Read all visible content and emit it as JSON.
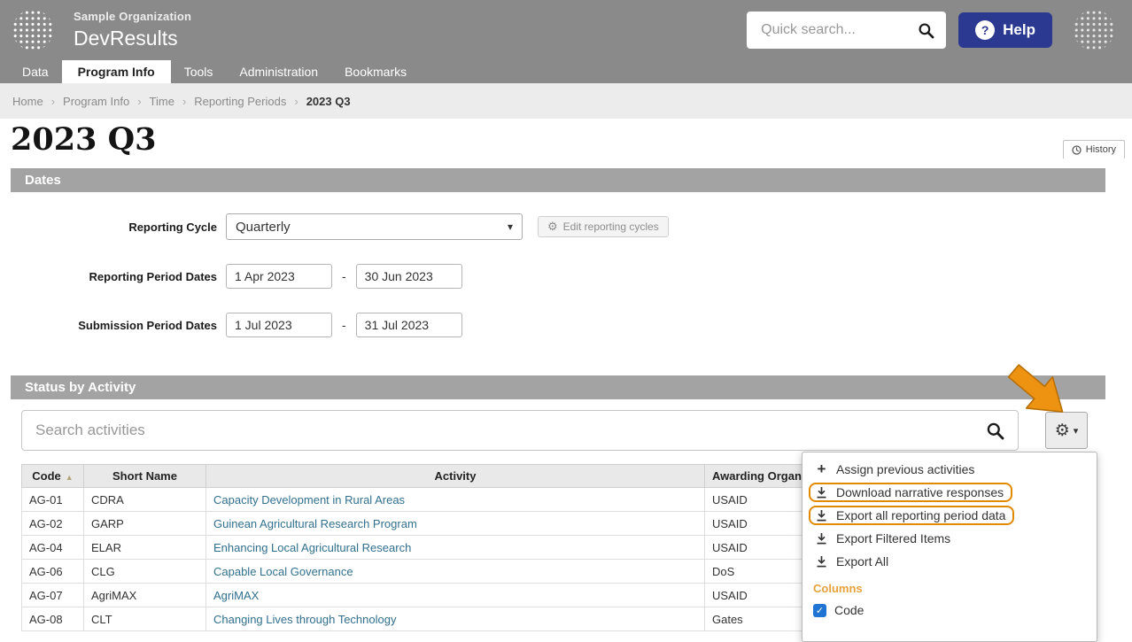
{
  "colors": {
    "header_gray": "#8a8a8a",
    "help_blue": "#2b3990",
    "link_blue": "#31708f",
    "accent_orange": "#ee9211",
    "highlight_outline_orange": "#e08a00",
    "columns_heading_orange": "#e8a23c",
    "checkbox_blue": "#1f74d4"
  },
  "header": {
    "org_name": "Sample Organization",
    "app_name": "DevResults",
    "quick_search_placeholder": "Quick search...",
    "help_label": "Help",
    "nav": [
      {
        "label": "Data"
      },
      {
        "label": "Program Info"
      },
      {
        "label": "Tools"
      },
      {
        "label": "Administration"
      },
      {
        "label": "Bookmarks"
      }
    ],
    "active_tab": "Program Info"
  },
  "breadcrumb": {
    "items": [
      "Home",
      "Program Info",
      "Time",
      "Reporting Periods",
      "2023 Q3"
    ]
  },
  "page": {
    "title": "2023 Q3",
    "history_button": "History"
  },
  "dates": {
    "section_title": "Dates",
    "reporting_cycle_label": "Reporting Cycle",
    "reporting_cycle_value": "Quarterly",
    "edit_cycles_button": "Edit reporting cycles",
    "reporting_period_label": "Reporting Period Dates",
    "reporting_period_start": "1 Apr 2023",
    "reporting_period_end": "30 Jun 2023",
    "submission_period_label": "Submission Period Dates",
    "submission_period_start": "1 Jul 2023",
    "submission_period_end": "31 Jul 2023",
    "range_separator": "-"
  },
  "status": {
    "section_title": "Status by Activity",
    "search_placeholder": "Search activities",
    "table": {
      "columns": [
        "Code",
        "Short Name",
        "Activity",
        "Awarding Organization"
      ],
      "sorted_column": "Code",
      "sort_direction": "asc",
      "rows": [
        {
          "code": "AG-01",
          "short_name": "CDRA",
          "activity": "Capacity Development in Rural Areas",
          "awarding_org": "USAID"
        },
        {
          "code": "AG-02",
          "short_name": "GARP",
          "activity": "Guinean Agricultural Research Program",
          "awarding_org": "USAID"
        },
        {
          "code": "AG-04",
          "short_name": "ELAR",
          "activity": "Enhancing Local Agricultural Research",
          "awarding_org": "USAID"
        },
        {
          "code": "AG-06",
          "short_name": "CLG",
          "activity": "Capable Local Governance",
          "awarding_org": "DoS"
        },
        {
          "code": "AG-07",
          "short_name": "AgriMAX",
          "activity": "AgriMAX",
          "awarding_org": "USAID"
        },
        {
          "code": "AG-08",
          "short_name": "CLT",
          "activity": "Changing Lives through Technology",
          "awarding_org": "Gates"
        }
      ]
    }
  },
  "gear_menu": {
    "items": [
      {
        "label": "Assign previous activities",
        "icon": "plus-icon",
        "highlighted": false
      },
      {
        "label": "Download narrative responses",
        "icon": "download-icon",
        "highlighted": true
      },
      {
        "label": "Export all reporting period data",
        "icon": "download-icon",
        "highlighted": true
      },
      {
        "label": "Export Filtered Items",
        "icon": "download-icon",
        "highlighted": false
      },
      {
        "label": "Export All",
        "icon": "download-icon",
        "highlighted": false
      }
    ],
    "columns_heading": "Columns",
    "column_options": [
      {
        "label": "Code",
        "checked": true
      }
    ]
  }
}
